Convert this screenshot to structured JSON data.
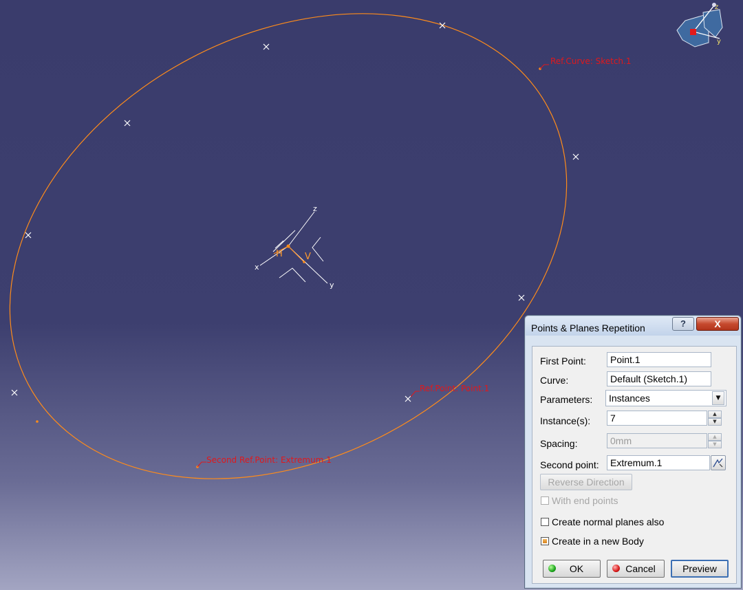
{
  "viewport": {
    "annotations": {
      "ref_curve": "Ref.Curve: Sketch.1",
      "ref_point": "Ref.Point: Point.1",
      "second_ref_point": "Second Ref.Point: Extremum.1"
    },
    "axis": {
      "x": "x",
      "y": "y",
      "z": "z",
      "h": "H",
      "v": "V"
    },
    "compass": {
      "z": "z",
      "y": "y"
    },
    "colors": {
      "curve": "#ff8c1a",
      "annotation": "#e0181c",
      "background": "#3a3c6c"
    }
  },
  "dialog": {
    "title": "Points & Planes Repetition",
    "help_glyph": "?",
    "close_glyph": "X",
    "first_point": {
      "label": "First Point:",
      "value": "Point.1"
    },
    "curve": {
      "label": "Curve:",
      "value": "Default (Sketch.1)"
    },
    "parameters": {
      "label": "Parameters:",
      "value": "Instances"
    },
    "instances": {
      "label": "Instance(s):",
      "value": "7"
    },
    "spacing": {
      "label": "Spacing:",
      "value": "0mm"
    },
    "second_point": {
      "label": "Second point:",
      "value": "Extremum.1"
    },
    "reverse_direction": "Reverse Direction",
    "with_end_points": "With end points",
    "create_normal_planes": "Create normal planes also",
    "create_new_body": "Create in a new Body",
    "ok": "OK",
    "cancel": "Cancel",
    "preview": "Preview"
  }
}
